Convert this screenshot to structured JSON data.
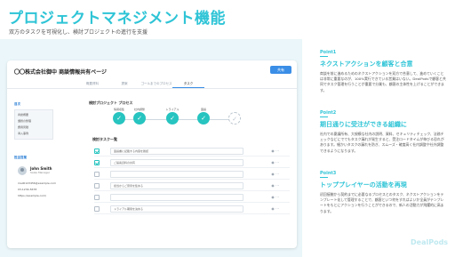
{
  "header": {
    "title": "プロジェクトマネジメント機能",
    "subtitle": "双方のタスクを可視化し、検討プロジェクトの進行を支援"
  },
  "mockup": {
    "title": "〇〇株式会社御中 商談情報共有ページ",
    "button_label": "共有",
    "tabs": [
      "概要資料",
      "提案",
      "ゴールまでのプロセス",
      "タスク"
    ],
    "active_tab": 3,
    "sidebar": {
      "section1_title": "目次",
      "items": [
        "商談概要",
        "課題の整理",
        "費用見積",
        "導入事例"
      ],
      "section2_title": "担当営業",
      "user_name": "John Smith",
      "user_role": "Sales Manager",
      "email": "mail0123456@example.com",
      "phone": "03-1234-5678",
      "url": "https://example.com/"
    },
    "process": {
      "title": "検討プロジェクト プロセス",
      "steps": [
        {
          "label": "情報収集",
          "state": "done"
        },
        {
          "label": "社内調整",
          "state": "done"
        },
        {
          "label": "トライアル",
          "state": "done"
        },
        {
          "label": "稟議",
          "state": "done"
        },
        {
          "label": "",
          "state": "pending"
        }
      ]
    },
    "tasks": {
      "title": "検討タスク一覧",
      "rows": [
        {
          "label": "稟議書に記載する内容を確認",
          "checked": true
        },
        {
          "label": "ご提案資料の共有",
          "checked": true
        },
        {
          "label": "",
          "checked": false
        },
        {
          "label": "担当からご意見を集める",
          "checked": false
        },
        {
          "label": "",
          "checked": false
        },
        {
          "label": "トライアル期間を決める",
          "checked": false
        }
      ],
      "icons": "◉ ⋯"
    }
  },
  "points": [
    {
      "label": "Point1",
      "title": "ネクストアクションを顧客と合意",
      "body": "商談を前に進めるためのネクストアクションを双方で合意して、進めていくことは非常に重要なのが、100%実行できている営業はいない。DealPodsで顧客と共同でタスク管理を行うことが重要で分業も、顧客の主体性を上げることができます。"
    },
    {
      "label": "Point2",
      "title": "期日通りに受注ができる組織に",
      "body": "社内での稟議所有、大規模な社内の説明、資料、セキュリティチェック、法務チェックなどにでてもタスク漏れが発生すると、受注ロードタイムが伸びる恐れがあります。細かいタスクの漏れを防ぎ、スムーズ・確度高く社内調整や社外調整できるようになります。"
    },
    {
      "label": "Point3",
      "title": "トッププレイヤーの活動を再現",
      "body": "初回接触から契約までに必要なるプロセスとのタスク、ネクストアクションをテンプレート化して管理することで、顧客といつ何をすればよいか全員がテンプレートをもとにアクションを行うことができるので、新人の活動力が飛躍的に高まります。"
    }
  ],
  "brand": {
    "logo_text": "DealPods",
    "accent": "#2ec4d6"
  }
}
